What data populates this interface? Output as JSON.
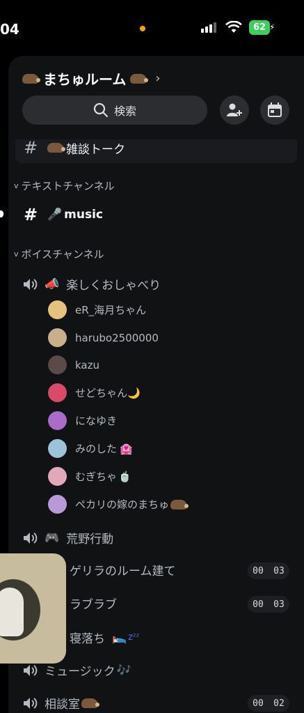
{
  "status_bar": {
    "time": "04",
    "battery": "62"
  },
  "server": {
    "name": "まちゅルーム"
  },
  "search": {
    "label": "検索"
  },
  "selected_channel": {
    "name": "雑談トーク"
  },
  "categories": {
    "text": "テキストチャンネル",
    "voice": "ボイスチャンネル"
  },
  "text_channels": [
    {
      "name": "music"
    }
  ],
  "voice_channels": [
    {
      "name": "楽しくおしゃべり"
    },
    {
      "name": "荒野行動"
    },
    {
      "name": "ゲリラのルーム建て",
      "timer": [
        "00",
        "03"
      ]
    },
    {
      "name": "ラブラブ",
      "timer": [
        "00",
        "03"
      ]
    },
    {
      "name": "寝落ち"
    },
    {
      "name": "ミュージック"
    },
    {
      "name": "相談室",
      "timer": [
        "00",
        "02"
      ]
    }
  ],
  "voice_users": [
    {
      "name": "eR_海月ちゃん",
      "color": "#e6c37a"
    },
    {
      "name": "harubo2500000",
      "color": "#c9b08a"
    },
    {
      "name": "kazu",
      "color": "#5a4a4a"
    },
    {
      "name": "せどちゃん",
      "color": "#d94a6a"
    },
    {
      "name": "になゆき",
      "color": "#a96cc9"
    },
    {
      "name": "みのした",
      "color": "#9cc4d8"
    },
    {
      "name": "むぎちゃ",
      "color": "#e0a8b8"
    },
    {
      "name": "ペカリの嫁のまちゅ",
      "color": "#b89ad8"
    }
  ]
}
